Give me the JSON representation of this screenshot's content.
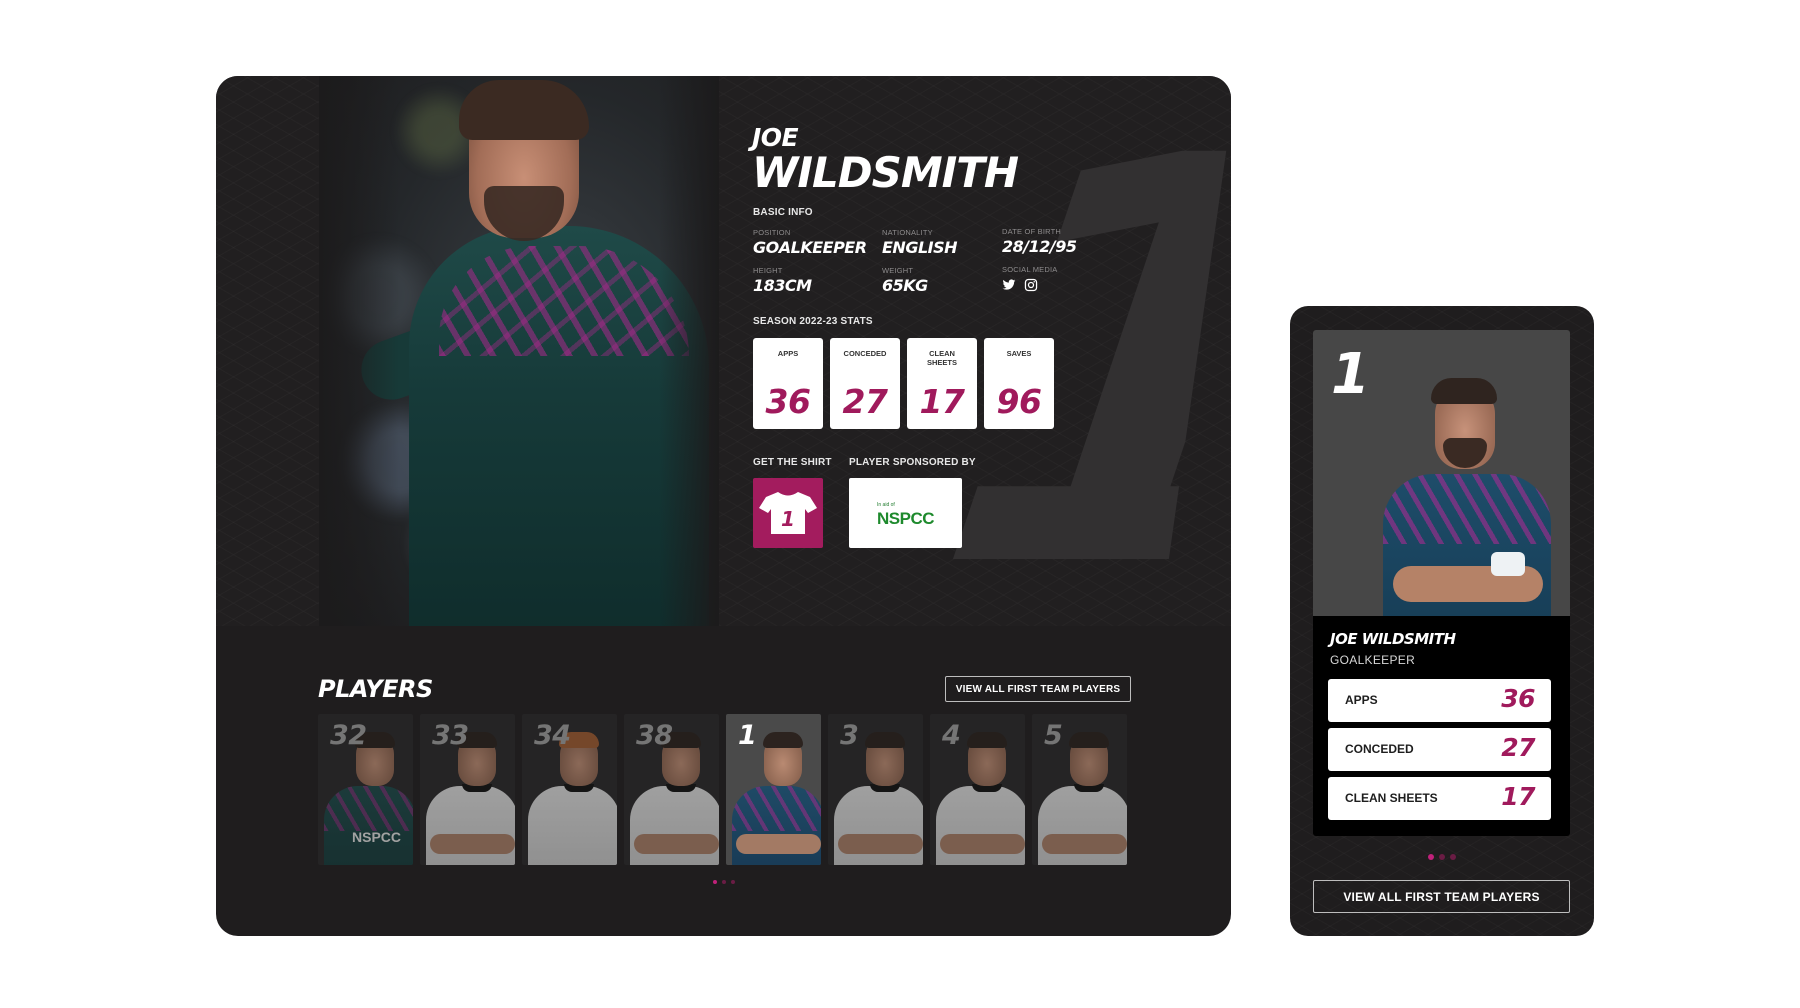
{
  "colors": {
    "accent": "#a01a5c",
    "background": "#1f1d1e",
    "card": "#ffffff",
    "sponsor_green": "#1e8a2d"
  },
  "player": {
    "first_name": "JOE",
    "last_name": "WILDSMITH",
    "full_name": "JOE WILDSMITH",
    "number": "1",
    "position_caption": "GOALKEEPER"
  },
  "basic_info": {
    "title": "BASIC INFO",
    "fields": [
      {
        "label": "POSITION",
        "value": "GOALKEEPER"
      },
      {
        "label": "NATIONALITY",
        "value": "ENGLISH"
      },
      {
        "label": "DATE OF BIRTH",
        "value": "28/12/95"
      },
      {
        "label": "HEIGHT",
        "value": "183CM"
      },
      {
        "label": "WEIGHT",
        "value": "65KG"
      },
      {
        "label": "SOCIAL MEDIA",
        "icons": [
          "twitter-icon",
          "instagram-icon"
        ]
      }
    ]
  },
  "season_stats": {
    "title": "SEASON 2022-23 STATS",
    "items": [
      {
        "label": "APPS",
        "value": "36"
      },
      {
        "label": "CONCEDED",
        "value": "27"
      },
      {
        "label": "CLEAN SHEETS",
        "value": "17"
      },
      {
        "label": "SAVES",
        "value": "96"
      }
    ]
  },
  "shirt": {
    "title": "GET THE SHIRT",
    "shirt_number": "1",
    "icon": "shirt-icon"
  },
  "sponsor": {
    "title": "PLAYER SPONSORED BY",
    "tagline": "In aid of",
    "name": "NSPCC"
  },
  "players_section": {
    "title": "PLAYERS",
    "view_all_label": "VIEW ALL FIRST TEAM PLAYERS",
    "players": [
      {
        "number": "32",
        "kit": "gk",
        "active": false,
        "shirt_sponsor": "NSPCC"
      },
      {
        "number": "33",
        "kit": "home",
        "active": false
      },
      {
        "number": "34",
        "kit": "home",
        "active": false
      },
      {
        "number": "38",
        "kit": "home",
        "active": false
      },
      {
        "number": "1",
        "kit": "gk2",
        "active": true
      },
      {
        "number": "3",
        "kit": "home",
        "active": false
      },
      {
        "number": "4",
        "kit": "home",
        "active": false
      },
      {
        "number": "5",
        "kit": "home",
        "active": false
      }
    ],
    "pagination": {
      "pages": 3,
      "current": 1
    }
  },
  "mobile": {
    "number": "1",
    "name": "JOE WILDSMITH",
    "position": "GOALKEEPER",
    "stats": [
      {
        "label": "APPS",
        "value": "36"
      },
      {
        "label": "CONCEDED",
        "value": "27"
      },
      {
        "label": "CLEAN SHEETS",
        "value": "17"
      }
    ],
    "pagination": {
      "pages": 3,
      "current": 1
    },
    "view_all_label": "VIEW ALL FIRST TEAM PLAYERS"
  }
}
